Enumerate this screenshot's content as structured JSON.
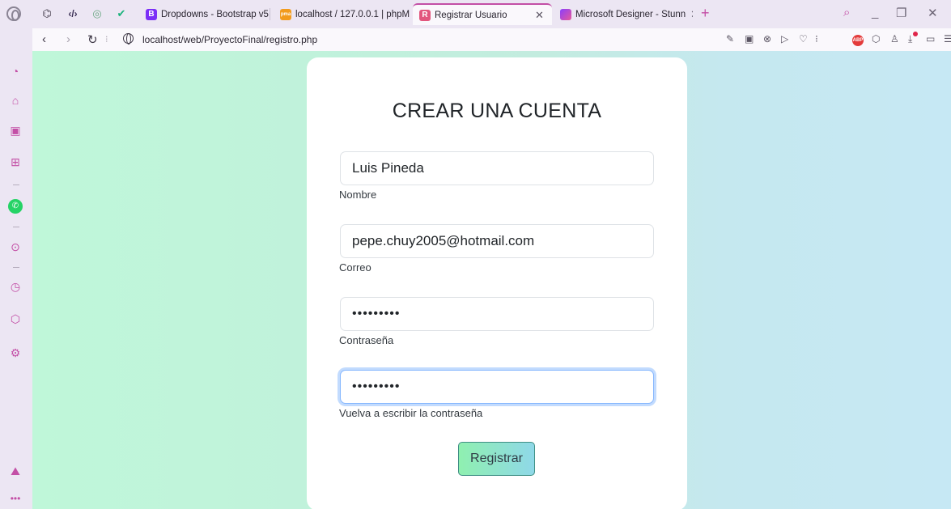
{
  "browser": {
    "tabs": [
      {
        "label": "Dropdowns - Bootstrap v5.",
        "favicon": "B"
      },
      {
        "label": "localhost / 127.0.0.1 | phpM",
        "favicon": "pma"
      },
      {
        "label": "Registrar Usuario",
        "favicon": "R"
      },
      {
        "label": "Microsoft Designer - Stunn",
        "favicon": "designer"
      }
    ],
    "url": "localhost/web/ProyectoFinal/registro.php",
    "abp_label": "ABP"
  },
  "form": {
    "title": "CREAR UNA CUENTA",
    "fields": [
      {
        "value": "Luis Pineda",
        "label": "Nombre"
      },
      {
        "value": "pepe.chuy2005@hotmail.com",
        "label": "Correo"
      },
      {
        "value": "•••••••••",
        "label": "Contraseña"
      },
      {
        "value": "•••••••••",
        "label": "Vuelva a escribir la contraseña"
      }
    ],
    "submit_label": "Registrar"
  },
  "colors": {
    "accent": "#c34fa6",
    "focus_ring": "#86b7fe",
    "card": "#ffffff"
  }
}
